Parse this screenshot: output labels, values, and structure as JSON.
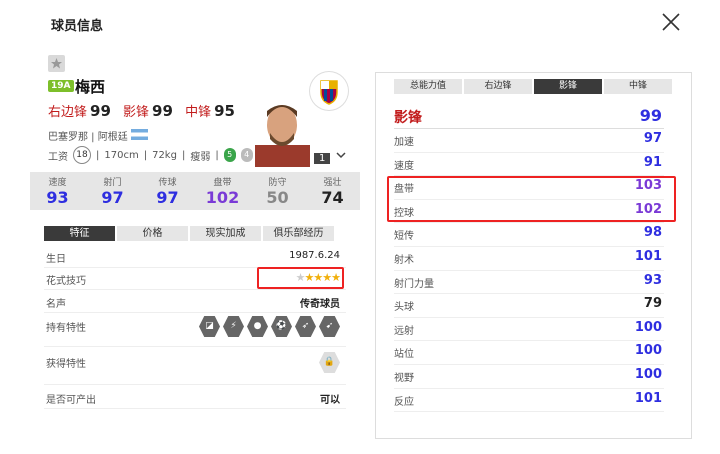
{
  "header": {
    "title": "球员信息"
  },
  "player": {
    "season_badge": "19A",
    "name": "梅西",
    "positions": [
      {
        "label": "右边锋",
        "value": "99"
      },
      {
        "label": "影锋",
        "value": "99"
      },
      {
        "label": "中锋",
        "value": "95"
      }
    ],
    "club": "巴塞罗那",
    "nation": "阿根廷",
    "wage_label": "工资",
    "wage": "18",
    "height": "170cm",
    "weight": "72kg",
    "build": "瘦弱",
    "skill_left": "5",
    "skill_right": "4",
    "level": "1"
  },
  "stats": [
    {
      "label": "速度",
      "value": "93",
      "color": "#2e2ee0"
    },
    {
      "label": "射门",
      "value": "97",
      "color": "#2e2ee0"
    },
    {
      "label": "传球",
      "value": "97",
      "color": "#2e2ee0"
    },
    {
      "label": "盘带",
      "value": "102",
      "color": "#7a3ad6"
    },
    {
      "label": "防守",
      "value": "50",
      "color": "#888888"
    },
    {
      "label": "强壮",
      "value": "74",
      "color": "#222222"
    }
  ],
  "tabs": [
    "特征",
    "价格",
    "现实加成",
    "俱乐部经历"
  ],
  "info": {
    "birthday_label": "生日",
    "birthday": "1987.6.24",
    "skill_label": "花式技巧",
    "skill_stars": 4,
    "skill_max": 5,
    "fame_label": "名声",
    "fame": "传奇球员",
    "traits_label": "持有特性",
    "acquire_label": "获得特性",
    "produce_label": "是否可产出",
    "produce": "可以"
  },
  "right_tabs": [
    "总能力值",
    "右边锋",
    "影锋",
    "中锋"
  ],
  "right_active": 2,
  "right_header": {
    "label": "影锋",
    "value": "99"
  },
  "right_rows": [
    {
      "label": "加速",
      "value": "97",
      "color": "#2e2ee0"
    },
    {
      "label": "速度",
      "value": "91",
      "color": "#2e2ee0"
    },
    {
      "label": "盘带",
      "value": "103",
      "color": "#7a3ad6"
    },
    {
      "label": "控球",
      "value": "102",
      "color": "#7a3ad6"
    },
    {
      "label": "短传",
      "value": "98",
      "color": "#2e2ee0"
    },
    {
      "label": "射术",
      "value": "101",
      "color": "#2e2ee0"
    },
    {
      "label": "射门力量",
      "value": "93",
      "color": "#2e2ee0"
    },
    {
      "label": "头球",
      "value": "79",
      "color": "#222222"
    },
    {
      "label": "远射",
      "value": "100",
      "color": "#2e2ee0"
    },
    {
      "label": "站位",
      "value": "100",
      "color": "#2e2ee0"
    },
    {
      "label": "视野",
      "value": "100",
      "color": "#2e2ee0"
    },
    {
      "label": "反应",
      "value": "101",
      "color": "#2e2ee0"
    }
  ]
}
